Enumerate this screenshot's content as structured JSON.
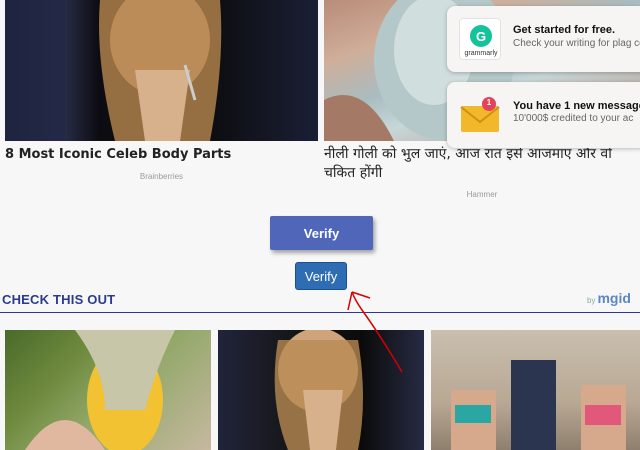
{
  "ads": [
    {
      "title": "8 Most Iconic Celeb Body Parts",
      "source": "Brainberries"
    },
    {
      "title": "नीली गोली को भुल जाएं, आज रात इसे आजमाएं और वो चकित होंगी",
      "source": "Hammer"
    }
  ],
  "notifications": [
    {
      "title": "Get started for free.",
      "body": "Check your writing for plag correct grammar.",
      "icon": "grammarly-icon",
      "icon_label": "grammarly"
    },
    {
      "title": "You have 1 new message",
      "body": "10'000$ credited to your ac",
      "icon": "mail-icon",
      "badge": "1"
    }
  ],
  "buttons": {
    "verify_primary": "Verify",
    "verify_secondary": "Verify"
  },
  "section": {
    "title": "CHECK THIS OUT",
    "brand_by": "by",
    "brand": "mgid"
  },
  "colors": {
    "verify_primary": "#5066b8",
    "verify_secondary": "#2e6db3",
    "section_title": "#2b3b8c",
    "brand": "#5b87c7",
    "annotation_arrow": "#d40000"
  }
}
